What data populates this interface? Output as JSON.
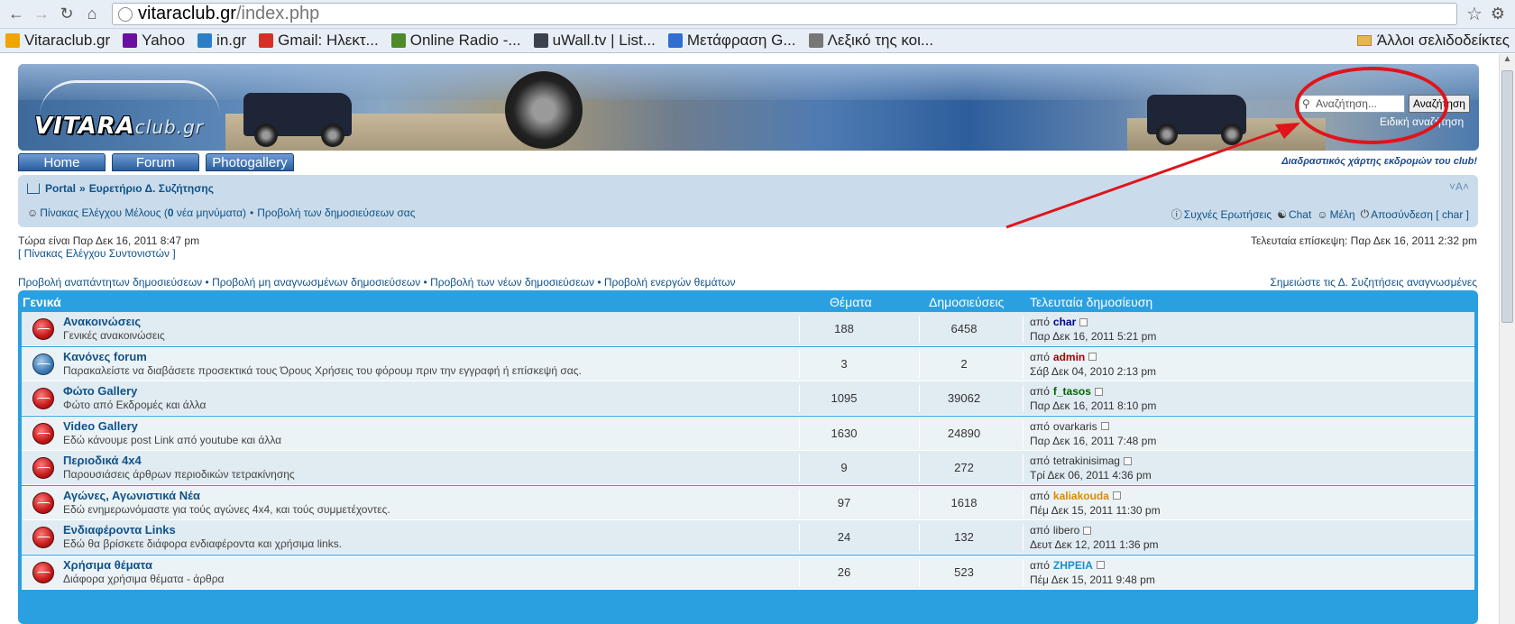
{
  "browser": {
    "url_host": "vitaraclub.gr",
    "url_path": "/index.php",
    "bookmarks": [
      {
        "label": "Vitaraclub.gr",
        "icon": "vitara-logo-icon",
        "color": "#f0a500"
      },
      {
        "label": "Yahoo",
        "icon": "yahoo-icon",
        "color": "#6b0fa3"
      },
      {
        "label": "in.gr",
        "icon": "in-gr-icon",
        "color": "#2a7fc7"
      },
      {
        "label": "Gmail: Ηλεκτ...",
        "icon": "gmail-icon",
        "color": "#d93025"
      },
      {
        "label": "Online Radio -...",
        "icon": "radio-icon",
        "color": "#4c8a2a"
      },
      {
        "label": "uWall.tv | List...",
        "icon": "uwall-icon",
        "color": "#3a4250"
      },
      {
        "label": "Μετάφραση G...",
        "icon": "translate-icon",
        "color": "#2f6fcf"
      },
      {
        "label": "Λεξικό της κοι...",
        "icon": "dictionary-icon",
        "color": "#777777"
      }
    ],
    "other_bookmarks": "Άλλοι σελιδοδείκτες"
  },
  "header": {
    "logo_main": "VITARA",
    "logo_suffix": "club.gr",
    "search_placeholder": "Αναζήτηση...",
    "search_button": "Αναζήτηση",
    "advanced_search": "Ειδική αναζήτηση"
  },
  "tabs": [
    "Home",
    "Forum",
    "Photogallery"
  ],
  "map_link": "Διαδραστικός χάρτης εκδρομών του club!",
  "navbar": {
    "crumb_portal": "Portal",
    "crumb_sep": "»",
    "crumb_index": "Ευρετήριο Δ. Συζήτησης",
    "font_size": "˅A˄",
    "ucp_prefix": "Πίνακας Ελέγχου Μέλους (",
    "ucp_count": "0",
    "ucp_suffix": " νέα μηνύματα)",
    "bullet": "•",
    "own_posts": "Προβολή των δημοσιεύσεων σας",
    "faq": "Συχνές Ερωτήσεις",
    "chat": "Chat",
    "members": "Μέλη",
    "logout": "Αποσύνδεση [ char ]"
  },
  "info": {
    "now": "Τώρα είναι Παρ Δεκ 16, 2011 8:47 pm",
    "mcp": "[ Πίνακας Ελέγχου Συντονιστών ]",
    "last_visit": "Τελευταία επίσκεψη: Παρ Δεκ 16, 2011 2:32 pm"
  },
  "quick": {
    "unanswered": "Προβολή αναπάντητων δημοσιεύσεων",
    "unread": "Προβολή μη αναγνωσμένων δημοσιεύσεων",
    "new": "Προβολή των νέων δημοσιεύσεων",
    "active": "Προβολή ενεργών θεμάτων",
    "mark_read": "Σημειώστε τις Δ. Συζητήσεις αναγνωσμένες"
  },
  "forum_table": {
    "category": "Γενικά",
    "col_topics": "Θέματα",
    "col_posts": "Δημοσιεύσεις",
    "col_last": "Τελευταία δημοσίευση",
    "by": "από",
    "rows": [
      {
        "title": "Ανακοινώσεις",
        "desc": "Γενικές ανακοινώσεις",
        "topics": "188",
        "posts": "6458",
        "user": "char",
        "user_color": "#00008b",
        "date": "Παρ Δεκ 16, 2011 5:21 pm",
        "icon": "red"
      },
      {
        "title": "Κανόνες forum",
        "desc": "Παρακαλείστε να διαβάσετε προσεκτικά τους Όρους Χρήσεις του φόρουμ πριν την εγγραφή ή επίσκεψή σας.",
        "topics": "3",
        "posts": "2",
        "user": "admin",
        "user_color": "#aa0000",
        "date": "Σάβ Δεκ 04, 2010 2:13 pm",
        "icon": "blue"
      },
      {
        "title": "Φώτο Gallery",
        "desc": "Φώτο από Εκδρομές και άλλα",
        "topics": "1095",
        "posts": "39062",
        "user": "f_tasos",
        "user_color": "#006600",
        "date": "Παρ Δεκ 16, 2011 8:10 pm",
        "icon": "red"
      },
      {
        "title": "Video Gallery",
        "desc": "Εδώ κάνουμε post Link από youtube και άλλα",
        "topics": "1630",
        "posts": "24890",
        "user": "ovarkaris",
        "user_color": "#333333",
        "date": "Παρ Δεκ 16, 2011 7:48 pm",
        "icon": "red"
      },
      {
        "title": "Περιοδικά 4x4",
        "desc": "Παρουσιάσεις άρθρων περιοδικών τετρακίνησης",
        "topics": "9",
        "posts": "272",
        "user": "tetrakinisimag",
        "user_color": "#333333",
        "date": "Τρί Δεκ 06, 2011 4:36 pm",
        "icon": "red"
      },
      {
        "title": "Αγώνες, Αγωνιστικά Νέα",
        "desc": "Εδώ ενημερωνόμαστε για τούς αγώνες 4x4, και τούς συμμετέχοντες.",
        "topics": "97",
        "posts": "1618",
        "user": "kaliakouda",
        "user_color": "#e08a00",
        "date": "Πέμ Δεκ 15, 2011 11:30 pm",
        "icon": "red"
      },
      {
        "title": "Ενδιαφέροντα Links",
        "desc": "Εδώ θα βρίσκετε διάφορα ενδιαφέροντα και χρήσιμα links.",
        "topics": "24",
        "posts": "132",
        "user": "libero",
        "user_color": "#333333",
        "date": "Δευτ Δεκ 12, 2011 1:36 pm",
        "icon": "red"
      },
      {
        "title": "Χρήσιμα θέματα",
        "desc": "Διάφορα χρήσιμα θέματα - άρθρα",
        "topics": "26",
        "posts": "523",
        "user": "ΖΗΡΕΙΑ",
        "user_color": "#1a8fc9",
        "date": "Πέμ Δεκ 15, 2011 9:48 pm",
        "icon": "red"
      }
    ]
  }
}
